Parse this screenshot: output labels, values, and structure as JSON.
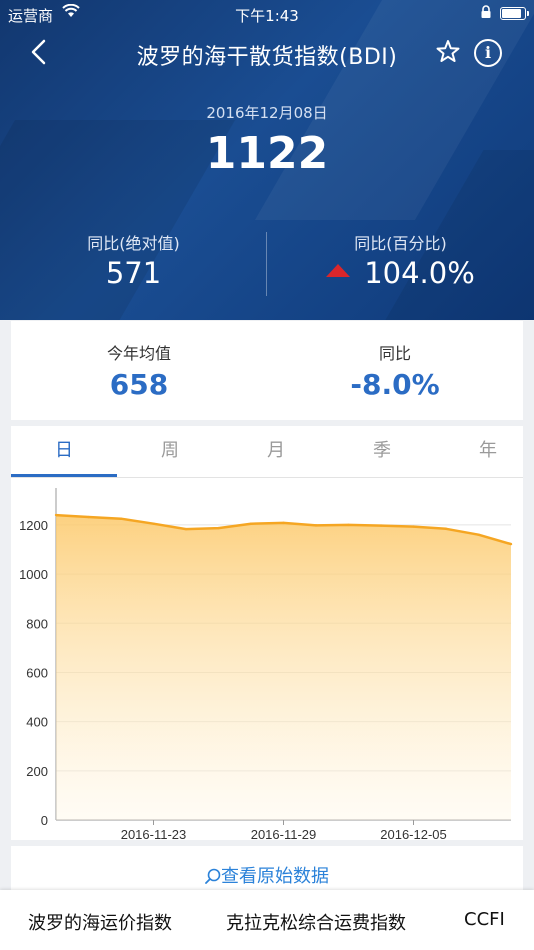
{
  "status_bar": {
    "carrier": "运营商",
    "time": "下午1:43",
    "battery_level": 0.95
  },
  "nav": {
    "title": "波罗的海干散货指数(BDI)",
    "info_glyph": "i"
  },
  "index": {
    "date": "2016年12月08日",
    "value": "1122"
  },
  "yoy": {
    "abs_label": "同比(绝对值)",
    "abs_value": "571",
    "pct_label": "同比(百分比)",
    "pct_value": "104.0%",
    "trend": "up"
  },
  "summary": {
    "avg_label": "今年均值",
    "avg_value": "658",
    "yoy_label": "同比",
    "yoy_value": "-8.0%"
  },
  "tabs": [
    {
      "label": "日"
    },
    {
      "label": "周"
    },
    {
      "label": "月"
    },
    {
      "label": "季"
    },
    {
      "label": "年"
    }
  ],
  "active_tab": 0,
  "raw_data_link": "查看原始数据",
  "bottom_nav": [
    {
      "label": "波罗的海运价指数"
    },
    {
      "label": "克拉克松综合运费指数"
    },
    {
      "label": "CCFI"
    }
  ],
  "colors": {
    "accent": "#2b6cc4",
    "up": "#d9262b",
    "line": "#f5a623"
  },
  "chart_data": {
    "type": "area",
    "x": [
      "2016-11-20",
      "2016-11-21",
      "2016-11-22",
      "2016-11-23",
      "2016-11-24",
      "2016-11-25",
      "2016-11-28",
      "2016-11-29",
      "2016-11-30",
      "2016-12-01",
      "2016-12-02",
      "2016-12-05",
      "2016-12-06",
      "2016-12-07",
      "2016-12-08"
    ],
    "values": [
      1240,
      1232,
      1225,
      1205,
      1183,
      1187,
      1205,
      1208,
      1198,
      1200,
      1197,
      1193,
      1184,
      1160,
      1122
    ],
    "xticks": [
      "2016-11-23",
      "2016-11-29",
      "2016-12-05"
    ],
    "yticks": [
      0,
      200,
      400,
      600,
      800,
      1000,
      1200
    ],
    "ylim": [
      0,
      1350
    ],
    "grid": true
  }
}
